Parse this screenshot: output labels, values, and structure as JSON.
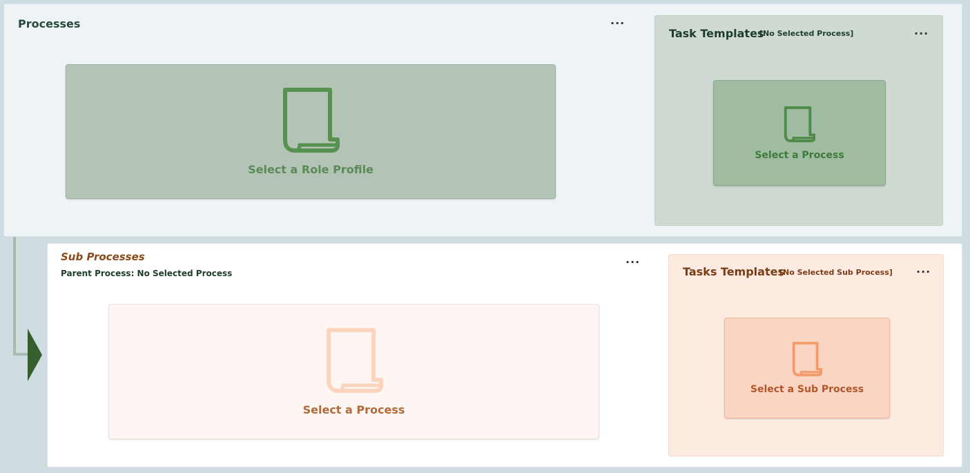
{
  "processes": {
    "title": "Processes",
    "menu": "...",
    "placeholder": "Select a Role Profile"
  },
  "task_templates": {
    "title": "Task Templates",
    "subtitle": "[No Selected Process]",
    "menu": "...",
    "placeholder": "Select a Process"
  },
  "sub_processes": {
    "title": "Sub Processes",
    "parent": "Parent Process: No Selected Process",
    "menu": "...",
    "placeholder": "Select a Process"
  },
  "tasks_templates": {
    "title": "Tasks Templates",
    "subtitle": "[No Selected Sub Process]",
    "menu": "...",
    "placeholder": "Select a Sub Process"
  },
  "icons": {
    "document": "document-icon",
    "menu": "more-icon",
    "connector": "arrow-right-icon"
  },
  "colors": {
    "green_dark": "#345e2c",
    "green_icon": "#4f8a4a",
    "orange_icon": "#f39a68"
  }
}
